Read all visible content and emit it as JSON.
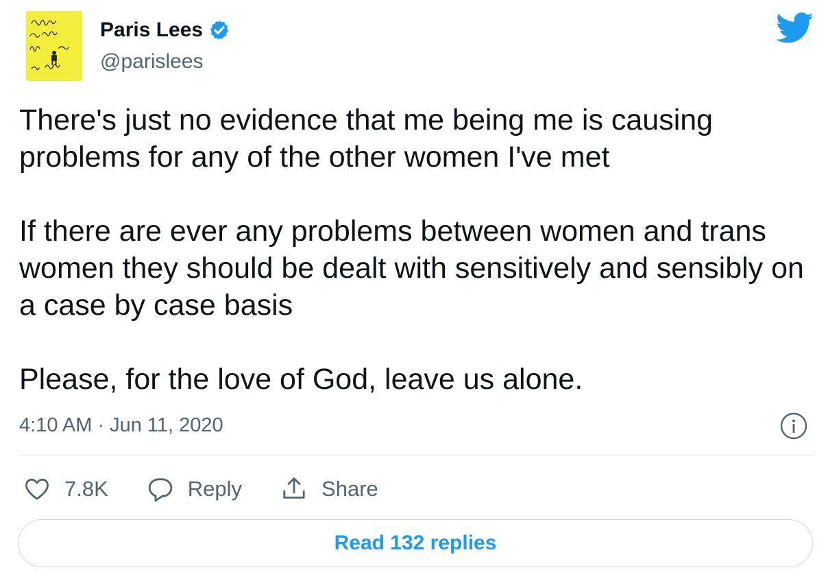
{
  "author": {
    "name": "Paris Lees",
    "handle": "@parislees"
  },
  "tweet": {
    "paragraphs": [
      "There's just no evidence that me being me is causing problems for any of the other women I've met",
      "If there are ever any problems between women and trans women they should be dealt with sensitively and sensibly on a case by case basis",
      "Please, for the love of God, leave us alone."
    ],
    "time": "4:10 AM",
    "separator": "·",
    "date": "Jun 11, 2020"
  },
  "actions": {
    "like_count": "7.8K",
    "reply_label": "Reply",
    "share_label": "Share"
  },
  "read_replies_label": "Read 132 replies",
  "icons": {
    "avatar": "avatar-book-cover",
    "verified": "verified-badge-icon",
    "brand": "twitter-bird-icon",
    "info": "info-icon",
    "like": "heart-icon",
    "reply": "speech-bubble-icon",
    "share": "share-upload-icon"
  },
  "colors": {
    "text": "#0f1419",
    "secondary": "#536471",
    "accent": "#1d9bf0",
    "avatar_bg": "#f3ee3c"
  }
}
